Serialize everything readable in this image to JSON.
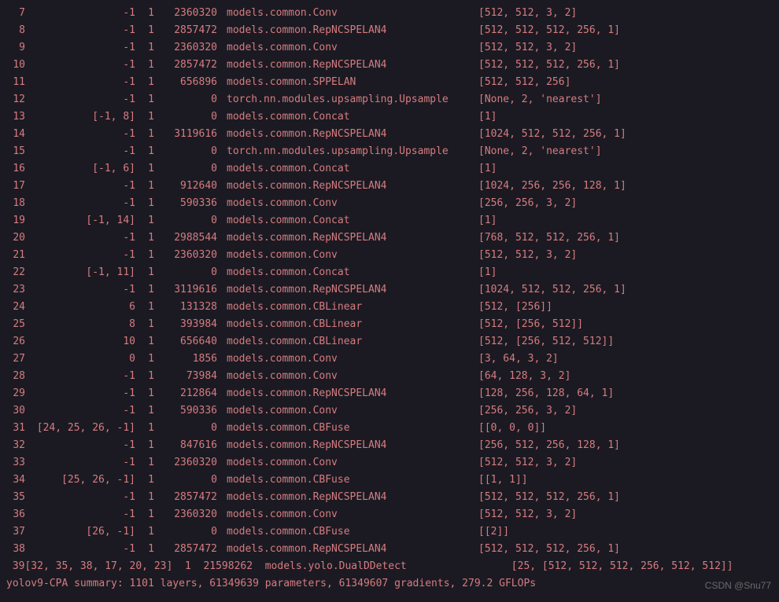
{
  "rows": [
    {
      "idx": "7",
      "from": "-1",
      "n": "1",
      "params": "2360320",
      "module": "models.common.Conv",
      "args": "[512, 512, 3, 2]"
    },
    {
      "idx": "8",
      "from": "-1",
      "n": "1",
      "params": "2857472",
      "module": "models.common.RepNCSPELAN4",
      "args": "[512, 512, 512, 256, 1]"
    },
    {
      "idx": "9",
      "from": "-1",
      "n": "1",
      "params": "2360320",
      "module": "models.common.Conv",
      "args": "[512, 512, 3, 2]"
    },
    {
      "idx": "10",
      "from": "-1",
      "n": "1",
      "params": "2857472",
      "module": "models.common.RepNCSPELAN4",
      "args": "[512, 512, 512, 256, 1]"
    },
    {
      "idx": "11",
      "from": "-1",
      "n": "1",
      "params": "656896",
      "module": "models.common.SPPELAN",
      "args": "[512, 512, 256]"
    },
    {
      "idx": "12",
      "from": "-1",
      "n": "1",
      "params": "0",
      "module": "torch.nn.modules.upsampling.Upsample",
      "args": "[None, 2, 'nearest']"
    },
    {
      "idx": "13",
      "from": "[-1, 8]",
      "n": "1",
      "params": "0",
      "module": "models.common.Concat",
      "args": "[1]"
    },
    {
      "idx": "14",
      "from": "-1",
      "n": "1",
      "params": "3119616",
      "module": "models.common.RepNCSPELAN4",
      "args": "[1024, 512, 512, 256, 1]"
    },
    {
      "idx": "15",
      "from": "-1",
      "n": "1",
      "params": "0",
      "module": "torch.nn.modules.upsampling.Upsample",
      "args": "[None, 2, 'nearest']"
    },
    {
      "idx": "16",
      "from": "[-1, 6]",
      "n": "1",
      "params": "0",
      "module": "models.common.Concat",
      "args": "[1]"
    },
    {
      "idx": "17",
      "from": "-1",
      "n": "1",
      "params": "912640",
      "module": "models.common.RepNCSPELAN4",
      "args": "[1024, 256, 256, 128, 1]"
    },
    {
      "idx": "18",
      "from": "-1",
      "n": "1",
      "params": "590336",
      "module": "models.common.Conv",
      "args": "[256, 256, 3, 2]"
    },
    {
      "idx": "19",
      "from": "[-1, 14]",
      "n": "1",
      "params": "0",
      "module": "models.common.Concat",
      "args": "[1]"
    },
    {
      "idx": "20",
      "from": "-1",
      "n": "1",
      "params": "2988544",
      "module": "models.common.RepNCSPELAN4",
      "args": "[768, 512, 512, 256, 1]"
    },
    {
      "idx": "21",
      "from": "-1",
      "n": "1",
      "params": "2360320",
      "module": "models.common.Conv",
      "args": "[512, 512, 3, 2]"
    },
    {
      "idx": "22",
      "from": "[-1, 11]",
      "n": "1",
      "params": "0",
      "module": "models.common.Concat",
      "args": "[1]"
    },
    {
      "idx": "23",
      "from": "-1",
      "n": "1",
      "params": "3119616",
      "module": "models.common.RepNCSPELAN4",
      "args": "[1024, 512, 512, 256, 1]"
    },
    {
      "idx": "24",
      "from": "6",
      "n": "1",
      "params": "131328",
      "module": "models.common.CBLinear",
      "args": "[512, [256]]"
    },
    {
      "idx": "25",
      "from": "8",
      "n": "1",
      "params": "393984",
      "module": "models.common.CBLinear",
      "args": "[512, [256, 512]]"
    },
    {
      "idx": "26",
      "from": "10",
      "n": "1",
      "params": "656640",
      "module": "models.common.CBLinear",
      "args": "[512, [256, 512, 512]]"
    },
    {
      "idx": "27",
      "from": "0",
      "n": "1",
      "params": "1856",
      "module": "models.common.Conv",
      "args": "[3, 64, 3, 2]"
    },
    {
      "idx": "28",
      "from": "-1",
      "n": "1",
      "params": "73984",
      "module": "models.common.Conv",
      "args": "[64, 128, 3, 2]"
    },
    {
      "idx": "29",
      "from": "-1",
      "n": "1",
      "params": "212864",
      "module": "models.common.RepNCSPELAN4",
      "args": "[128, 256, 128, 64, 1]"
    },
    {
      "idx": "30",
      "from": "-1",
      "n": "1",
      "params": "590336",
      "module": "models.common.Conv",
      "args": "[256, 256, 3, 2]"
    },
    {
      "idx": "31",
      "from": "[24, 25, 26, -1]",
      "n": "1",
      "params": "0",
      "module": "models.common.CBFuse",
      "args": "[[0, 0, 0]]"
    },
    {
      "idx": "32",
      "from": "-1",
      "n": "1",
      "params": "847616",
      "module": "models.common.RepNCSPELAN4",
      "args": "[256, 512, 256, 128, 1]"
    },
    {
      "idx": "33",
      "from": "-1",
      "n": "1",
      "params": "2360320",
      "module": "models.common.Conv",
      "args": "[512, 512, 3, 2]"
    },
    {
      "idx": "34",
      "from": "[25, 26, -1]",
      "n": "1",
      "params": "0",
      "module": "models.common.CBFuse",
      "args": "[[1, 1]]"
    },
    {
      "idx": "35",
      "from": "-1",
      "n": "1",
      "params": "2857472",
      "module": "models.common.RepNCSPELAN4",
      "args": "[512, 512, 512, 256, 1]"
    },
    {
      "idx": "36",
      "from": "-1",
      "n": "1",
      "params": "2360320",
      "module": "models.common.Conv",
      "args": "[512, 512, 3, 2]"
    },
    {
      "idx": "37",
      "from": "[26, -1]",
      "n": "1",
      "params": "0",
      "module": "models.common.CBFuse",
      "args": "[[2]]"
    },
    {
      "idx": "38",
      "from": "-1",
      "n": "1",
      "params": "2857472",
      "module": "models.common.RepNCSPELAN4",
      "args": "[512, 512, 512, 256, 1]"
    }
  ],
  "last_row": {
    "raw": " 39[32, 35, 38, 17, 20, 23]  1  21598262  models.yolo.DualDDetect                 [25, [512, 512, 512, 256, 512, 512]]"
  },
  "summary": "yolov9-CPA summary: 1101 layers, 61349639 parameters, 61349607 gradients, 279.2 GFLOPs",
  "watermark": "CSDN @Snu77"
}
